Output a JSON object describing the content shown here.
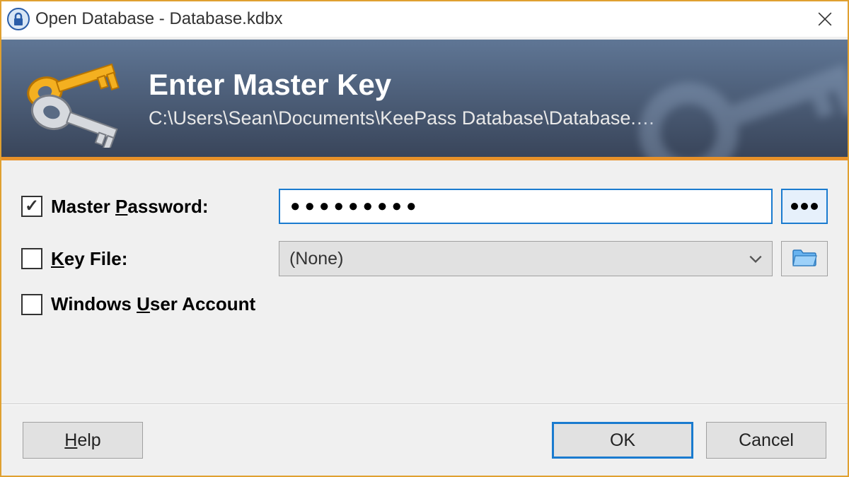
{
  "titlebar": {
    "text": "Open Database - Database.kdbx"
  },
  "banner": {
    "title": "Enter Master Key",
    "path": "C:\\Users\\Sean\\Documents\\KeePass  Database\\Database.…"
  },
  "form": {
    "masterPassword": {
      "label_pre": "Master ",
      "label_ul": "P",
      "label_post": "assword:",
      "checked": true,
      "value": "●●●●●●●●●"
    },
    "keyFile": {
      "label_ul": "K",
      "label_post": "ey File:",
      "checked": false,
      "selected": "(None)"
    },
    "windowsAccount": {
      "label_pre": "Windows ",
      "label_ul": "U",
      "label_post": "ser Account",
      "checked": false
    }
  },
  "footer": {
    "help_ul": "H",
    "help_post": "elp",
    "ok": "OK",
    "cancel": "Cancel"
  },
  "colors": {
    "accent": "#1a7bcf",
    "border_orange": "#e0a030"
  }
}
